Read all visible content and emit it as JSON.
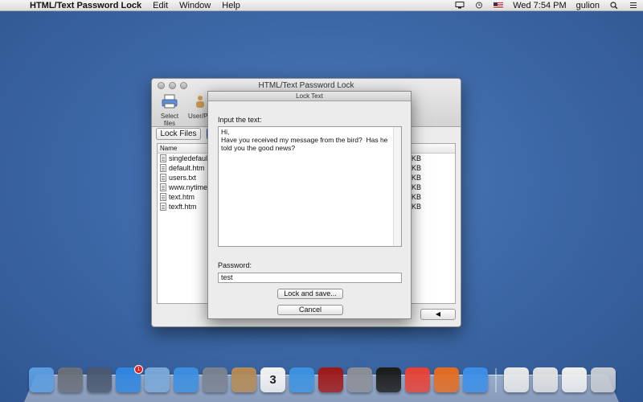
{
  "menubar": {
    "apple_glyph": "",
    "app_name": "HTML/Text Password Lock",
    "menus": [
      "Edit",
      "Window",
      "Help"
    ],
    "clock": "Wed 7:54 PM",
    "user": "gulion"
  },
  "main_window": {
    "title": "HTML/Text Password Lock",
    "toolbar": {
      "select_files_label": "Select files",
      "user_label": "User/P"
    },
    "lock_files_button": "Lock Files",
    "table": {
      "name_header": "Name",
      "rows": [
        {
          "name": "singledefaul",
          "size": "KB"
        },
        {
          "name": "default.htm",
          "size": "KB"
        },
        {
          "name": "users.txt",
          "size": "KB"
        },
        {
          "name": "www.nytime",
          "size": "KB"
        },
        {
          "name": "text.htm",
          "size": "KB"
        },
        {
          "name": "texft.htm",
          "size": "KB"
        }
      ]
    },
    "back_button": "◀"
  },
  "sheet": {
    "title": "Lock Text",
    "input_label": "Input the text:",
    "input_text": "Hi,\nHave you received my message from the bird?  Has he told you the good news?",
    "password_label": "Password:",
    "password_value": "test",
    "lock_save_button": "Lock and save...",
    "cancel_button": "Cancel"
  },
  "dock": {
    "items": [
      {
        "name": "finder",
        "icon": "finder-icon",
        "color": "#5b9de0"
      },
      {
        "name": "launchpad",
        "icon": "launchpad-icon",
        "color": "#6b6f78"
      },
      {
        "name": "mission-control",
        "icon": "mission-control-icon",
        "color": "#4a5870"
      },
      {
        "name": "app-store",
        "icon": "app-store-icon",
        "color": "#2f86e0",
        "badge": "1"
      },
      {
        "name": "mail",
        "icon": "mail-icon",
        "color": "#7aa8d8"
      },
      {
        "name": "safari",
        "icon": "safari-icon",
        "color": "#3b8ee0"
      },
      {
        "name": "facetime",
        "icon": "facetime-icon",
        "color": "#7a8290"
      },
      {
        "name": "contacts",
        "icon": "contacts-icon",
        "color": "#b58a55"
      },
      {
        "name": "calendar",
        "icon": "calendar-icon",
        "color": "#f3f3f3",
        "label": "3"
      },
      {
        "name": "itunes",
        "icon": "itunes-icon",
        "color": "#3c92e0"
      },
      {
        "name": "photo-booth",
        "icon": "photo-booth-icon",
        "color": "#a01818"
      },
      {
        "name": "system-preferences",
        "icon": "system-preferences-icon",
        "color": "#8c8f96"
      },
      {
        "name": "terminal",
        "icon": "terminal-icon",
        "color": "#1b1b1b"
      },
      {
        "name": "chrome",
        "icon": "chrome-icon",
        "color": "#e94235"
      },
      {
        "name": "firefox",
        "icon": "firefox-icon",
        "color": "#e66c1f"
      },
      {
        "name": "password-lock",
        "icon": "password-lock-app-icon",
        "color": "#3b8fe8"
      },
      {
        "name": "htm-document",
        "icon": "htm-file-icon",
        "color": "#e9e9e9"
      },
      {
        "name": "zip-document",
        "icon": "zip-file-icon",
        "color": "#e1e1e1"
      },
      {
        "name": "downloads",
        "icon": "downloads-stack-icon",
        "color": "#f0f0f0"
      },
      {
        "name": "trash",
        "icon": "trash-icon",
        "color": "#c8ccd2"
      }
    ]
  }
}
